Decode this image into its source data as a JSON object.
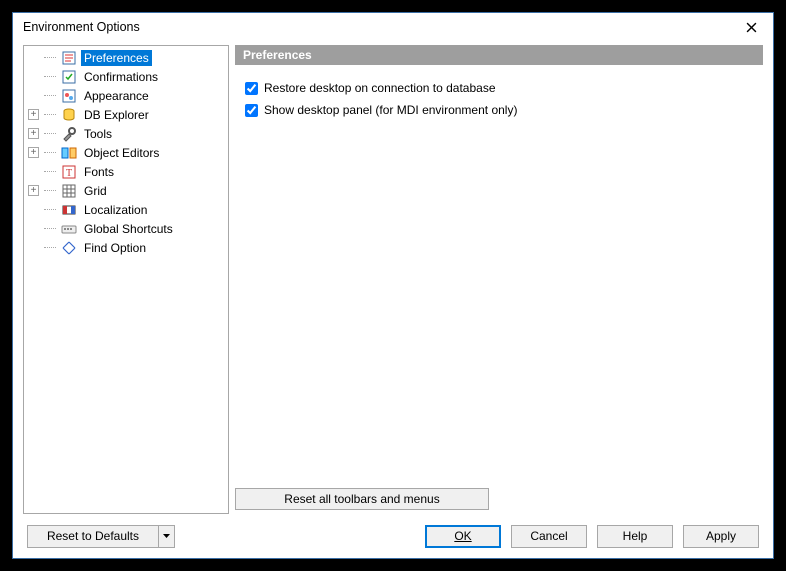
{
  "window": {
    "title": "Environment Options"
  },
  "tree": {
    "items": [
      {
        "label": "Preferences",
        "expandable": false,
        "selected": true,
        "icon": "prefs"
      },
      {
        "label": "Confirmations",
        "expandable": false,
        "icon": "confirm"
      },
      {
        "label": "Appearance",
        "expandable": false,
        "icon": "appearance"
      },
      {
        "label": "DB Explorer",
        "expandable": true,
        "icon": "dbexp"
      },
      {
        "label": "Tools",
        "expandable": true,
        "icon": "tools"
      },
      {
        "label": "Object Editors",
        "expandable": true,
        "icon": "objed"
      },
      {
        "label": "Fonts",
        "expandable": false,
        "icon": "fonts"
      },
      {
        "label": "Grid",
        "expandable": true,
        "icon": "grid"
      },
      {
        "label": "Localization",
        "expandable": false,
        "icon": "local"
      },
      {
        "label": "Global Shortcuts",
        "expandable": false,
        "icon": "shortcut"
      },
      {
        "label": "Find Option",
        "expandable": false,
        "icon": "find"
      }
    ]
  },
  "panel": {
    "title": "Preferences",
    "options": [
      {
        "label": "Restore desktop on connection to database",
        "checked": true
      },
      {
        "label": "Show desktop panel (for MDI environment only)",
        "checked": true
      }
    ],
    "reset_toolbars": "Reset all toolbars and menus"
  },
  "buttons": {
    "reset_defaults": "Reset to Defaults",
    "ok": "OK",
    "cancel": "Cancel",
    "help": "Help",
    "apply": "Apply"
  }
}
